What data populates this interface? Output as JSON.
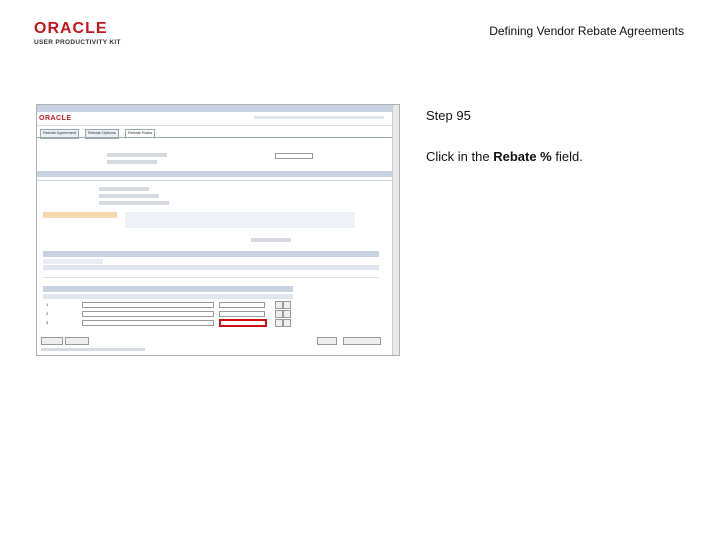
{
  "header": {
    "logo_brand": "ORACLE",
    "logo_sub": "USER PRODUCTIVITY KIT",
    "doc_title": "Defining Vendor Rebate Agreements"
  },
  "step": {
    "label": "Step 95",
    "instruction_prefix": "Click in the ",
    "instruction_field": "Rebate %",
    "instruction_suffix": " field."
  },
  "screenshot": {
    "oracle_logo": "ORACLE",
    "tabs": [
      "Rebate Agreement",
      "Rebate Options",
      "Rebate Rules"
    ],
    "rebate_rule_rows": [
      "1",
      "2",
      "3"
    ],
    "rebate_percent_values": [
      "",
      "",
      ""
    ],
    "colors": {
      "highlight": "#d01010",
      "grid_header": "#c7d3e3",
      "brand_red": "#c4161c"
    }
  }
}
